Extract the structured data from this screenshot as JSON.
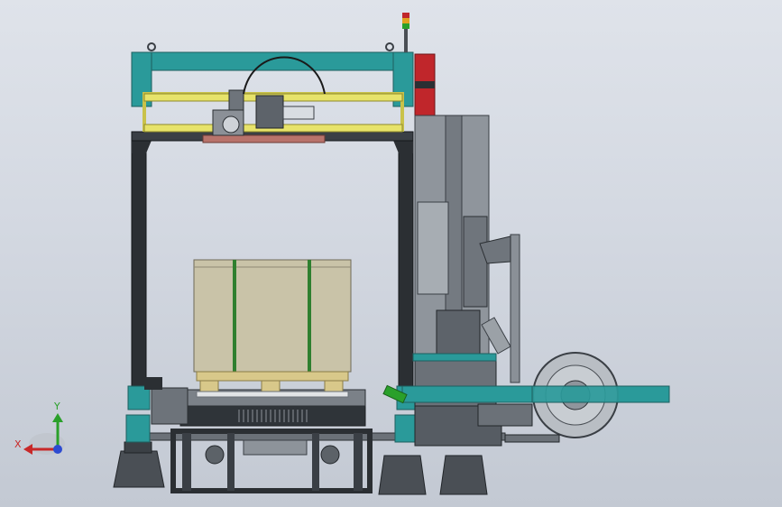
{
  "viewport": {
    "background_top": "#dfe3ea",
    "background_bottom": "#c3c9d3"
  },
  "colors": {
    "frame_teal": "#2a9a9a",
    "frame_dark": "#2b2f33",
    "yellow": "#e7e36a",
    "pallet_box": "#c9c3a8",
    "pallet_wood": "#d8c88a",
    "strap_green": "#2f7f2f",
    "tower_grey": "#8f959c",
    "beacon_red": "#c0262b",
    "coil_grey": "#b9bec4"
  },
  "triad": {
    "y_label": "Y",
    "x_label": "X",
    "y_color": "#2aa02a",
    "x_color": "#c82828",
    "z_color": "#2d4bd1"
  }
}
